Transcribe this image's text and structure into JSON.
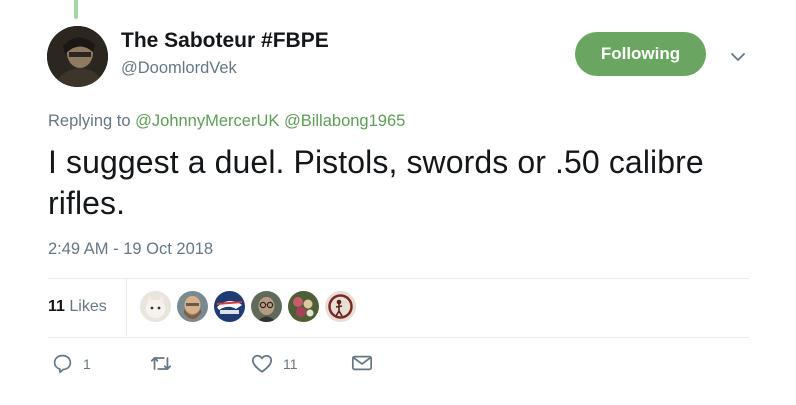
{
  "author": {
    "display_name": "The Saboteur #FBPE",
    "handle": "@DoomlordVek",
    "avatar_icon": "avatar-photo"
  },
  "follow_button": {
    "label": "Following",
    "color": "#6aa562"
  },
  "menu_icon": "chevron-down-icon",
  "reply": {
    "prefix": "Replying to",
    "mentions": [
      "@JohnnyMercerUK",
      "@Billabong1965"
    ]
  },
  "tweet": {
    "text": "I suggest a duel. Pistols, swords or .50 calibre rifles.",
    "timestamp": "2:49 AM - 19 Oct 2018"
  },
  "likes": {
    "count": "11",
    "label": "Likes",
    "liker_avatars": [
      "avatar-cat",
      "avatar-bearded-man",
      "avatar-seahawks-logo",
      "avatar-man-glasses",
      "avatar-flowers",
      "avatar-figure"
    ]
  },
  "actions": {
    "reply_count": "1",
    "retweet_count": "",
    "like_count": "11",
    "icons": [
      "reply-icon",
      "retweet-icon",
      "heart-icon",
      "message-icon"
    ]
  },
  "colors": {
    "link": "#5e9e56",
    "muted": "#657786",
    "text": "#14171a"
  }
}
